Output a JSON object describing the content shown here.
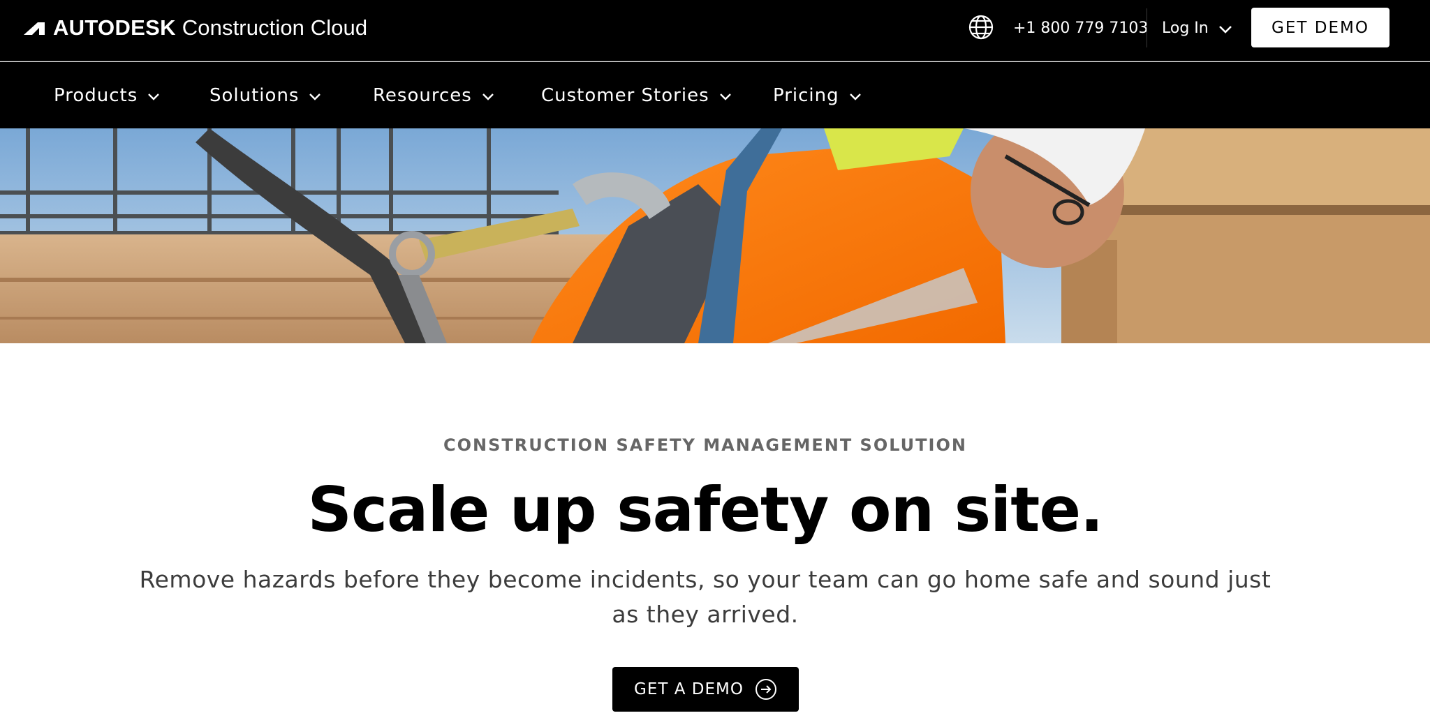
{
  "header": {
    "brand_name": "AUTODESK",
    "brand_product": "Construction Cloud",
    "phone": "+1 800 779 7103",
    "login_label": "Log In",
    "get_demo_label": "GET DEMO"
  },
  "nav": {
    "items": [
      {
        "label": "Products"
      },
      {
        "label": "Solutions"
      },
      {
        "label": "Resources"
      },
      {
        "label": "Customer Stories"
      },
      {
        "label": "Pricing"
      }
    ]
  },
  "hero": {
    "eyebrow": "CONSTRUCTION SAFETY MANAGEMENT SOLUTION",
    "headline": "Scale up safety on site.",
    "subhead": "Remove hazards before they become incidents, so your team can go home safe and sound just as they arrived.",
    "cta_label": "GET A DEMO"
  },
  "icons": {
    "logo": "autodesk-logo-icon",
    "language": "globe-icon",
    "dropdown": "chevron-down-icon",
    "cta": "arrow-circle-right-icon"
  },
  "colors": {
    "header_bg": "#000000",
    "text_primary": "#000000",
    "eyebrow": "#666666",
    "subhead": "#3c3c3c",
    "cta_bg": "#000000"
  }
}
